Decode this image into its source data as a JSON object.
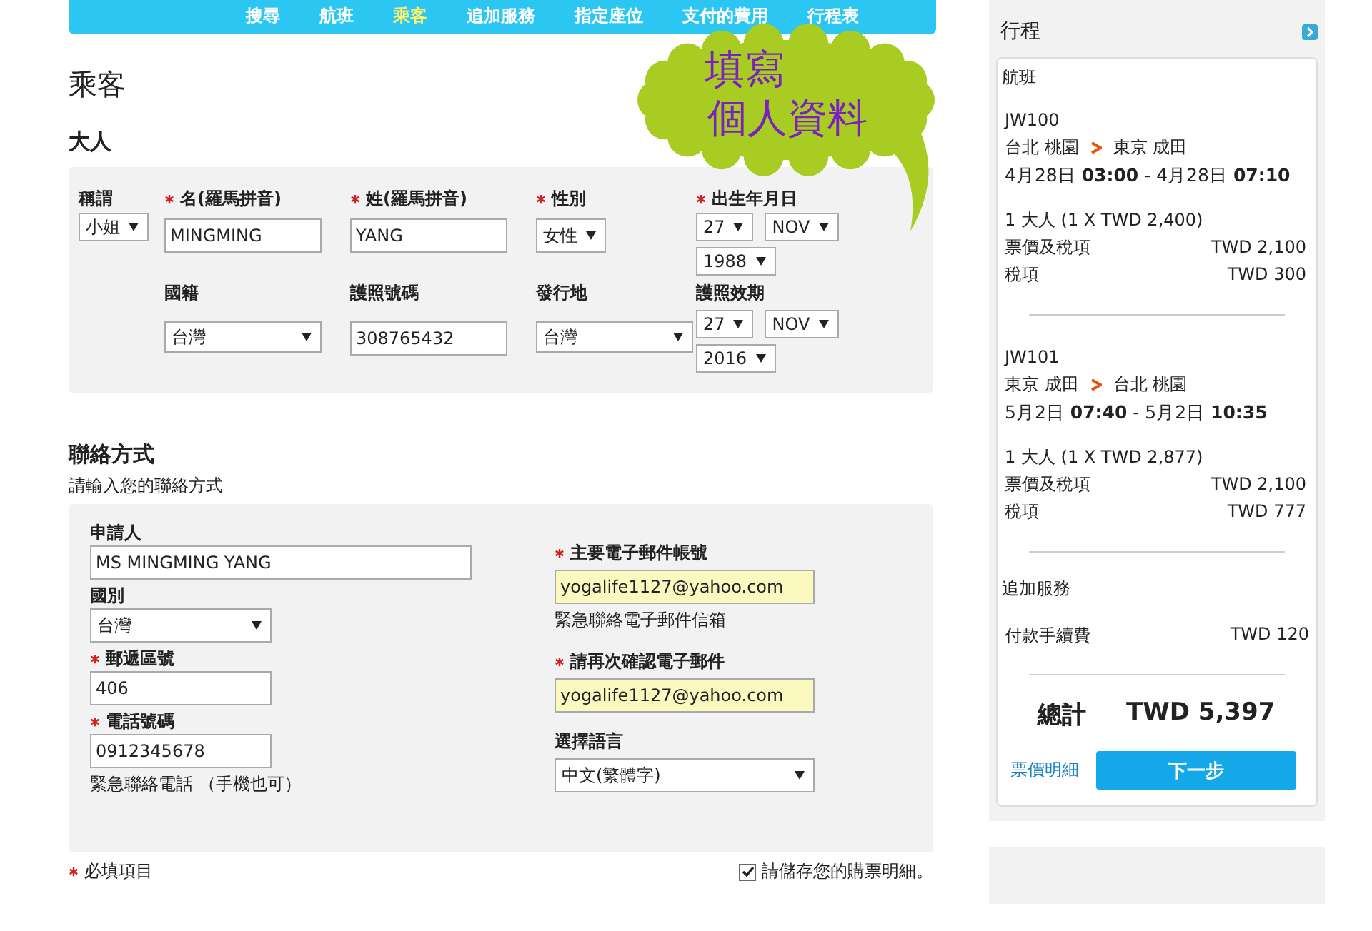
{
  "nav": [
    {
      "label": "搜尋",
      "selected": false
    },
    {
      "label": "航班",
      "selected": false
    },
    {
      "label": "乘客",
      "selected": true
    },
    {
      "label": "追加服務",
      "selected": false
    },
    {
      "label": "指定座位",
      "selected": false
    },
    {
      "label": "支付的費用",
      "selected": false
    },
    {
      "label": "行程表",
      "selected": false
    }
  ],
  "callout": {
    "lines": [
      "填寫",
      "個人資料"
    ]
  },
  "page_title": "乘客",
  "adult": {
    "title": "大人",
    "rows": [
      [
        {
          "label": "稱謂",
          "required": false,
          "controls": [
            {
              "kind": "select",
              "value": "小姐"
            }
          ]
        },
        {
          "label": "名(羅馬拼音)",
          "required": true,
          "controls": [
            {
              "kind": "input",
              "value": "MINGMING"
            }
          ]
        },
        {
          "label": "姓(羅馬拼音)",
          "required": true,
          "controls": [
            {
              "kind": "input",
              "value": "YANG"
            }
          ]
        },
        {
          "label": "性別",
          "required": true,
          "controls": [
            {
              "kind": "select",
              "value": "女性"
            }
          ]
        },
        {
          "label": "出生年月日",
          "required": true,
          "controls": [
            {
              "kind": "select",
              "value": "27"
            },
            {
              "kind": "select",
              "value": "NOV"
            },
            {
              "kind": "select",
              "value": "1988"
            }
          ]
        }
      ],
      [
        "",
        {
          "label": "國籍",
          "required": false,
          "controls": [
            {
              "kind": "select",
              "value": "台灣"
            }
          ]
        },
        {
          "label": "護照號碼",
          "required": false,
          "controls": [
            {
              "kind": "input",
              "value": "308765432"
            }
          ]
        },
        {
          "label": "發行地",
          "required": false,
          "controls": [
            {
              "kind": "select",
              "value": "台灣"
            }
          ]
        },
        {
          "label": "護照效期",
          "required": false,
          "controls": [
            {
              "kind": "select",
              "value": "27"
            },
            {
              "kind": "select",
              "value": "NOV"
            },
            {
              "kind": "select",
              "value": "2016"
            }
          ]
        }
      ]
    ]
  },
  "contact": {
    "title": "聯絡方式",
    "subtitle": "請輸入您的聯絡方式",
    "left": [
      {
        "label": "申請人",
        "required": false,
        "kind": "input",
        "value": "MS MINGMING YANG",
        "wide": true
      },
      {
        "label": "國別",
        "required": false,
        "kind": "select",
        "value": "台灣",
        "wide": false
      },
      {
        "label": "郵遞區號",
        "required": true,
        "kind": "input",
        "value": "406",
        "wide": false
      },
      {
        "label": "電話號碼",
        "required": true,
        "kind": "input",
        "value": "0912345678",
        "wide": false,
        "hint": "緊急聯絡電話 （手機也可）"
      }
    ],
    "right": [
      {
        "label": "主要電子郵件帳號",
        "required": true,
        "kind": "email",
        "value": "yogalife1127@yahoo.com",
        "hint": "緊急聯絡電子郵件信箱"
      },
      {
        "label": "請再次確認電子郵件",
        "required": true,
        "kind": "email",
        "value": "yogalife1127@yahoo.com"
      },
      {
        "label": "選擇語言",
        "required": false,
        "kind": "select",
        "value": "中文(繁體字)"
      }
    ]
  },
  "footer": {
    "required_note": "必填項目",
    "save": {
      "label": "請儲存您的購票明細。",
      "checked": true
    }
  },
  "sidebar": {
    "title": "行程",
    "flights_header": "航班",
    "flights": [
      {
        "code": "JW100",
        "from": "台北 桃園",
        "to": "東京 成田",
        "times": "4月28日 **03:00** - 4月28日 **07:10**",
        "pax": "1 大人 (1 X TWD 2,400)",
        "lines": [
          {
            "label": "票價及稅項",
            "amount": "TWD 2,100"
          },
          {
            "label": "稅項",
            "amount": "TWD 300"
          }
        ]
      },
      {
        "code": "JW101",
        "from": "東京 成田",
        "to": "台北 桃園",
        "times": "5月2日 **07:40** - 5月2日 **10:35**",
        "pax": "1 大人 (1 X TWD 2,877)",
        "lines": [
          {
            "label": "票價及稅項",
            "amount": "TWD 2,100"
          },
          {
            "label": "稅項",
            "amount": "TWD 777"
          }
        ]
      }
    ],
    "extras_header": "追加服務",
    "extras": [
      {
        "label": "付款手續費",
        "amount": "TWD 120"
      }
    ],
    "total_label": "總計",
    "total": "TWD 5,397",
    "details_link": "票價明細",
    "next_button": "下一步"
  }
}
